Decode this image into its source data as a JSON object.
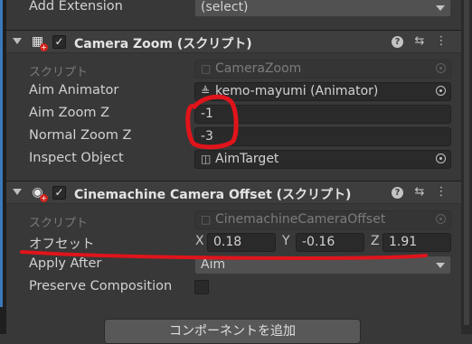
{
  "add_extension": {
    "label": "Add Extension",
    "value": "(select)"
  },
  "camera_zoom": {
    "title": "Camera Zoom (スクリプト)",
    "script_label": "スクリプト",
    "script_value": "CameraZoom",
    "aim_animator_label": "Aim Animator",
    "aim_animator_value": "kemo-mayumi (Animator)",
    "aim_zoom_label": "Aim Zoom Z",
    "aim_zoom_value": "-1",
    "normal_zoom_label": "Normal Zoom Z",
    "normal_zoom_value": "-3",
    "inspect_label": "Inspect Object",
    "inspect_value": "AimTarget"
  },
  "cinemachine_offset": {
    "title": "Cinemachine Camera Offset (スクリプト)",
    "script_label": "スクリプト",
    "script_value": "CinemachineCameraOffset",
    "offset_label": "オフセット",
    "x_label": "X",
    "x_value": "0.18",
    "y_label": "Y",
    "y_value": "-0.16",
    "z_label": "Z",
    "z_value": "1.91",
    "apply_after_label": "Apply After",
    "apply_after_value": "Aim",
    "preserve_label": "Preserve Composition"
  },
  "add_component_button": "コンポーネントを追加",
  "icons": {
    "fold": "triangle-down-icon",
    "help": "help-icon",
    "presets": "sliders-icon",
    "menu": "kebab-menu-icon",
    "picker": "object-picker-icon",
    "script": "script-file-icon",
    "animator": "animator-icon",
    "gameobject": "cube-icon"
  },
  "colors": {
    "background": "#383838",
    "header": "#3e3e3e",
    "field": "#2a2a2a",
    "annotation": "#e0141b",
    "selection_strip": "#3a79bb"
  }
}
